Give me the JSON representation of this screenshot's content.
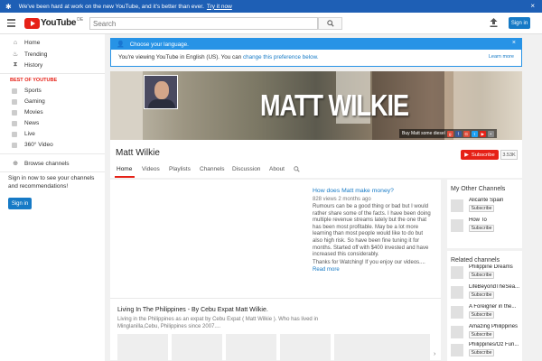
{
  "announcement": {
    "text": "We've been hard at work on the new YouTube, and it's better than ever.",
    "link": "Try it now",
    "close": "×"
  },
  "masthead": {
    "logo": "YouTube",
    "region": "DE",
    "search_placeholder": "Search",
    "signin": "Sign in"
  },
  "guide": {
    "items": [
      {
        "label": "Home",
        "icon": "home-icon"
      },
      {
        "label": "Trending",
        "icon": "flame-icon"
      },
      {
        "label": "History",
        "icon": "hourglass-icon"
      }
    ],
    "best_header": "BEST OF YOUTUBE",
    "best": [
      "Sports",
      "Gaming",
      "Movies",
      "News",
      "Live",
      "360° Video"
    ],
    "browse": "Browse channels",
    "signin_text": "Sign in now to see your channels and recommendations!",
    "signin_button": "Sign in"
  },
  "lang": {
    "title": "Choose your language.",
    "body": "You're viewing YouTube in English (US). You can",
    "link": "change this preference below.",
    "learn_more": "Learn more",
    "close": "×"
  },
  "banner": {
    "title": "MATT WILKIE",
    "link": "Buy Matt some diesel"
  },
  "channel": {
    "name": "Matt Wilkie",
    "subscribe": "Subscribe",
    "subscriber_count": "3.53K",
    "tabs": [
      "Home",
      "Videos",
      "Playlists",
      "Channels",
      "Discussion",
      "About"
    ]
  },
  "featured": {
    "title": "How does Matt make money?",
    "meta": "828 views  2 months ago",
    "desc_lines": [
      "Rumours can be a good thing or bad but I would",
      "rather share some of the facts. I have been doing",
      "multiple revenue streams lately but the one that",
      "has been most profitable. May be a lot more",
      "learning than most people would like to do but",
      "also high risk. So have been fine tuning it for",
      "months. Started off with $400 invested and have",
      "increased this considerably."
    ],
    "thanks": "Thanks for Watching! If you enjoy our videos....",
    "read_more": "Read more"
  },
  "shelf": {
    "title": "Living In The Philippines - By Cebu Expat Matt Wilkie.",
    "desc_lines": [
      "Living in the Philippines as an expat by Cebu Expat ( Matt Wilkie ). Who has lived in",
      "Minglanilla,Cebu, Philippines since 2007...."
    ]
  },
  "my_channels": {
    "title": "My Other Channels",
    "items": [
      {
        "name": "Alicante Spain",
        "button": "Subscribe"
      },
      {
        "name": "How To",
        "button": "Subscribe"
      }
    ]
  },
  "related": {
    "title": "Related channels",
    "items": [
      {
        "name": "Philippine Dreams",
        "button": "Subscribe"
      },
      {
        "name": "LifeBeyondTheSea...",
        "button": "Subscribe"
      },
      {
        "name": "A Foreigner in the...",
        "button": "Subscribe"
      },
      {
        "name": "Amazing Philippines",
        "button": "Subscribe"
      },
      {
        "name": "Philippines/Oz Fun...",
        "button": "Subscribe"
      }
    ]
  }
}
